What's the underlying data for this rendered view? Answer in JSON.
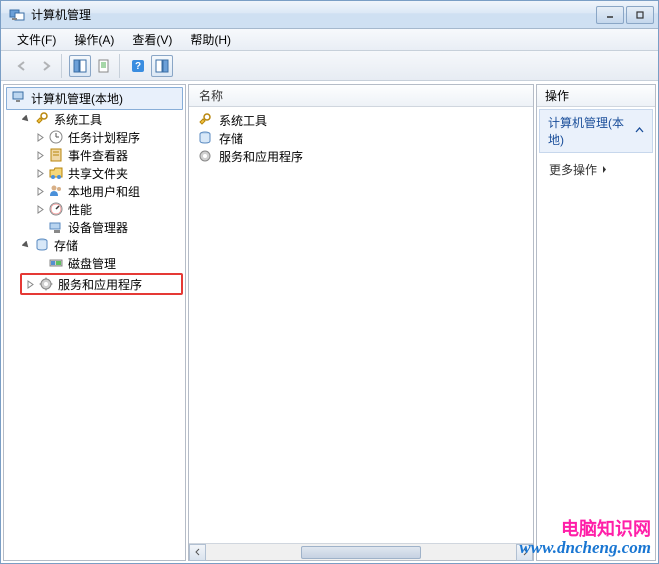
{
  "window": {
    "title": "计算机管理"
  },
  "menu": {
    "file": "文件(F)",
    "action": "操作(A)",
    "view": "查看(V)",
    "help": "帮助(H)"
  },
  "tree": {
    "root": "计算机管理(本地)",
    "system_tools": "系统工具",
    "task_scheduler": "任务计划程序",
    "event_viewer": "事件查看器",
    "shared_folders": "共享文件夹",
    "local_users": "本地用户和组",
    "performance": "性能",
    "device_manager": "设备管理器",
    "storage": "存储",
    "disk_management": "磁盘管理",
    "services_apps": "服务和应用程序"
  },
  "list": {
    "header_name": "名称",
    "items": {
      "system_tools": "系统工具",
      "storage": "存储",
      "services_apps": "服务和应用程序"
    }
  },
  "actions": {
    "header": "操作",
    "section_title": "计算机管理(本地)",
    "more_actions": "更多操作"
  },
  "watermark": {
    "line1": "电脑知识网",
    "line2": "www.dncheng.com"
  }
}
